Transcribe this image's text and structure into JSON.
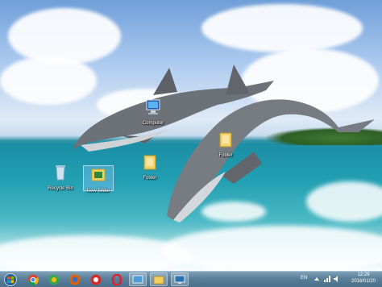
{
  "desktop": {
    "icons": [
      {
        "label": "Computer",
        "icon": "computer-icon"
      },
      {
        "label": "Recycle Bin",
        "icon": "recycle-bin-icon"
      },
      {
        "label": "New folder",
        "icon": "folder-image-icon"
      },
      {
        "label": "Folder",
        "icon": "folder-icon"
      },
      {
        "label": "Folder",
        "icon": "folder-icon"
      }
    ]
  },
  "taskbar": {
    "start_icon": "windows-start-icon",
    "pinned": [
      {
        "name": "chrome-browser-icon"
      },
      {
        "name": "opera-icon"
      },
      {
        "name": "firefox-icon"
      },
      {
        "name": "app-icon"
      },
      {
        "name": "opera-red-icon"
      },
      {
        "name": "desktop-preview-icon"
      },
      {
        "name": "explorer-folder-icon"
      },
      {
        "name": "monitor-icon"
      }
    ],
    "tray": {
      "language": "EN",
      "time": "12:29",
      "date": "2016/01/20"
    }
  },
  "colors": {
    "taskbar": "#5a7f99",
    "sky": "#a9c8ee",
    "sea": "#23a0b3"
  }
}
